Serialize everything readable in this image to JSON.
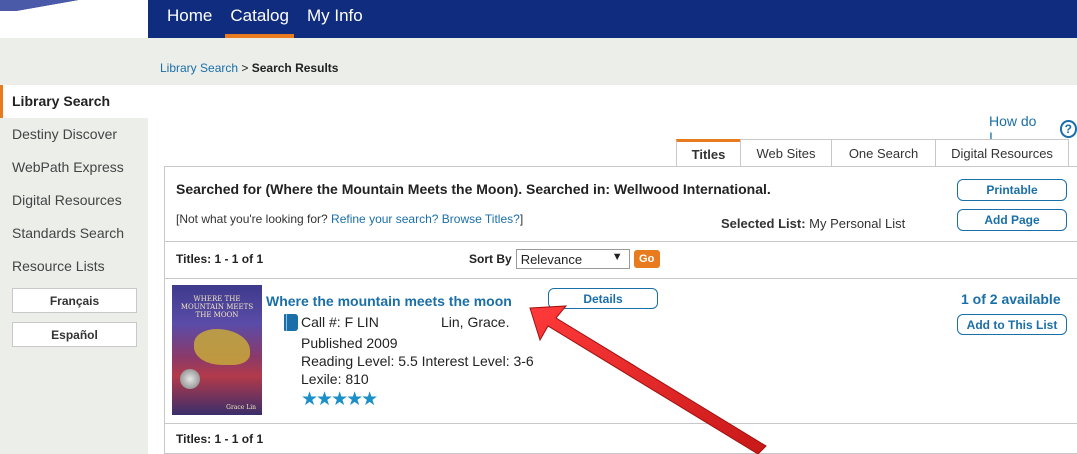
{
  "nav": {
    "items": [
      {
        "label": "Home",
        "active": false
      },
      {
        "label": "Catalog",
        "active": true
      },
      {
        "label": "My Info",
        "active": false
      }
    ],
    "accent": "#e87b1e",
    "background": "#0f2c7f"
  },
  "breadcrumb": {
    "link": "Library Search",
    "separator": " > ",
    "current": "Search Results"
  },
  "sidebar": {
    "items": [
      {
        "label": "Library Search",
        "active": true
      },
      {
        "label": "Destiny Discover"
      },
      {
        "label": "WebPath Express"
      },
      {
        "label": "Digital Resources"
      },
      {
        "label": "Standards Search"
      },
      {
        "label": "Resource Lists"
      }
    ],
    "languages": [
      "Français",
      "Español"
    ]
  },
  "help": {
    "label": "How do I...",
    "icon": "question-circle-icon",
    "symbol": "?"
  },
  "tabs": [
    {
      "label": "Titles",
      "active": true
    },
    {
      "label": "Web Sites"
    },
    {
      "label": "One Search"
    },
    {
      "label": "Digital Resources"
    }
  ],
  "results": {
    "searched_for": "Searched for (Where the Mountain Meets the Moon). Searched in: Wellwood International.",
    "not_what_prefix": "[Not what you're looking for? ",
    "refine_link": "Refine your search?",
    "browse_link": "Browse Titles?",
    "not_what_suffix": "]",
    "selected_list_label": "Selected List:",
    "selected_list_value": "My Personal List",
    "printable_button": "Printable",
    "add_page_button": "Add Page",
    "count_top": "Titles: 1 - 1 of 1",
    "count_bottom": "Titles: 1 - 1 of 1",
    "sort_label": "Sort By",
    "sort_value": "Relevance",
    "sort_caret": "▼",
    "go_button": "Go"
  },
  "item": {
    "cover_title": "Where the Mountain Meets the Moon",
    "cover_author": "Grace Lin",
    "title": "Where the mountain meets the moon",
    "details_button": "Details",
    "call_number": "Call #: F LIN",
    "author": "Lin, Grace.",
    "published": "Published 2009",
    "reading_level": "Reading Level: 5.5  Interest Level: 3-6",
    "lexile": "Lexile: 810",
    "stars": "★★★★★",
    "rating": 5,
    "availability": "1 of 2 available",
    "add_to_list_button": "Add to This List",
    "material_icon": "book-icon"
  },
  "annotation": {
    "type": "red-arrow",
    "color": "#e02424"
  }
}
